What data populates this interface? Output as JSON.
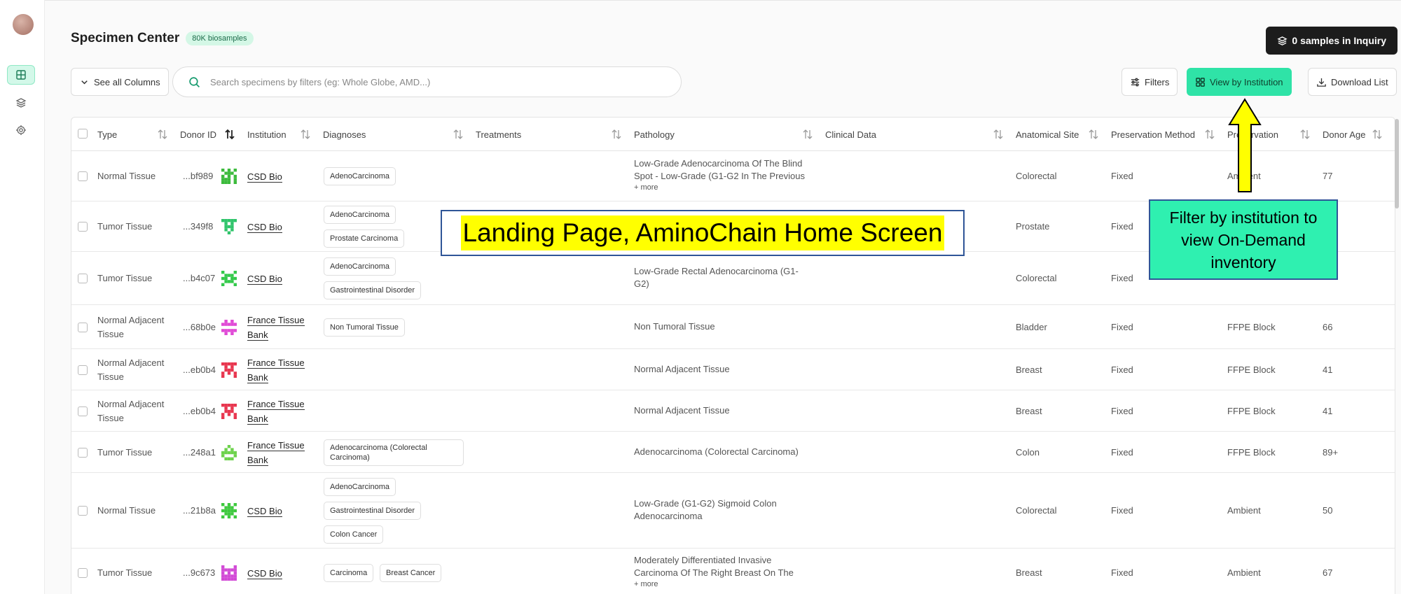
{
  "header": {
    "title": "Specimen Center",
    "badge": "80K biosamples",
    "inquiry_label": "0 samples in Inquiry"
  },
  "toolbar": {
    "see_columns_label": "See all Columns",
    "search_placeholder": "Search specimens by filters (eg: Whole Globe, AMD...)",
    "filters_label": "Filters",
    "view_by_institution_label": "View by Institution",
    "download_label": "Download List"
  },
  "table": {
    "columns": [
      "Type",
      "Donor ID",
      "Institution",
      "Diagnoses",
      "Treatments",
      "Pathology",
      "Clinical Data",
      "Anatomical Site",
      "Preservation Method",
      "Preservation",
      "Donor Age"
    ],
    "rows": [
      {
        "type": [
          "Normal Tissue"
        ],
        "donor_id": "...bf989",
        "identicon_color": "#3cba3c",
        "institution": [
          "CSD Bio"
        ],
        "diagnoses": [
          "AdenoCarcinoma"
        ],
        "pathology": [
          "Low-Grade Adenocarcinoma Of The Blind",
          "Spot - Low-Grade (G1-G2 In The Previous"
        ],
        "more": "+ more",
        "site": "Colorectal",
        "method": "Fixed",
        "preservation": "Ambient",
        "age": "77"
      },
      {
        "type": [
          "Tumor Tissue"
        ],
        "donor_id": "...349f8",
        "identicon_color": "#2fc46a",
        "institution": [
          "CSD Bio"
        ],
        "diagnoses": [
          "AdenoCarcinoma",
          "Prostate Carcinoma"
        ],
        "pathology": [],
        "more": "",
        "site": "Prostate",
        "method": "Fixed",
        "preservation": "",
        "age": ""
      },
      {
        "type": [
          "Tumor Tissue"
        ],
        "donor_id": "...b4c07",
        "identicon_color": "#33c94a",
        "institution": [
          "CSD Bio"
        ],
        "diagnoses": [
          "AdenoCarcinoma",
          "Gastrointestinal Disorder"
        ],
        "pathology": [
          "Low-Grade Rectal Adenocarcinoma (G1-",
          "G2)"
        ],
        "more": "",
        "site": "Colorectal",
        "method": "Fixed",
        "preservation": "",
        "age": ""
      },
      {
        "type": [
          "Normal Adjacent",
          "Tissue"
        ],
        "donor_id": "...68b0e",
        "identicon_color": "#e04ad6",
        "institution": [
          "France Tissue",
          "Bank"
        ],
        "diagnoses": [
          "Non Tumoral Tissue"
        ],
        "pathology": [
          "Non Tumoral Tissue"
        ],
        "more": "",
        "site": "Bladder",
        "method": "Fixed",
        "preservation": "FFPE Block",
        "age": "66"
      },
      {
        "type": [
          "Normal Adjacent",
          "Tissue"
        ],
        "donor_id": "...eb0b4",
        "identicon_color": "#e8364f",
        "institution": [
          "France Tissue",
          "Bank"
        ],
        "diagnoses": [],
        "pathology": [
          "Normal Adjacent Tissue"
        ],
        "more": "",
        "site": "Breast",
        "method": "Fixed",
        "preservation": "FFPE Block",
        "age": "41"
      },
      {
        "type": [
          "Normal Adjacent",
          "Tissue"
        ],
        "donor_id": "...eb0b4",
        "identicon_color": "#e8364f",
        "institution": [
          "France Tissue",
          "Bank"
        ],
        "diagnoses": [],
        "pathology": [
          "Normal Adjacent Tissue"
        ],
        "more": "",
        "site": "Breast",
        "method": "Fixed",
        "preservation": "FFPE Block",
        "age": "41"
      },
      {
        "type": [
          "Tumor Tissue"
        ],
        "donor_id": "...248a1",
        "identicon_color": "#6dd24c",
        "institution": [
          "France Tissue",
          "Bank"
        ],
        "diagnoses": [
          "Adenocarcinoma (Colorectal Carcinoma)"
        ],
        "pathology": [
          "Adenocarcinoma (Colorectal Carcinoma)"
        ],
        "more": "",
        "site": "Colon",
        "method": "Fixed",
        "preservation": "FFPE Block",
        "age": "89+"
      },
      {
        "type": [
          "Normal Tissue"
        ],
        "donor_id": "...21b8a",
        "identicon_color": "#3ec93e",
        "institution": [
          "CSD Bio"
        ],
        "diagnoses": [
          "AdenoCarcinoma",
          "Gastrointestinal Disorder",
          "Colon Cancer"
        ],
        "pathology": [
          "Low-Grade (G1-G2) Sigmoid Colon",
          "Adenocarcinoma"
        ],
        "more": "",
        "site": "Colorectal",
        "method": "Fixed",
        "preservation": "Ambient",
        "age": "50"
      },
      {
        "type": [
          "Tumor Tissue"
        ],
        "donor_id": "...9c673",
        "identicon_color": "#d24bd6",
        "institution": [
          "CSD Bio"
        ],
        "diagnoses": [
          "Carcinoma",
          "Breast Cancer"
        ],
        "pathology": [
          "Moderately Differentiated Invasive",
          "Carcinoma Of The Right Breast On The"
        ],
        "more": "+ more",
        "site": "Breast",
        "method": "Fixed",
        "preservation": "Ambient",
        "age": "67"
      }
    ]
  },
  "annotations": {
    "title": "Landing Page, AminoChain Home Screen",
    "callout": "Filter by institution to view On-Demand inventory"
  },
  "colors": {
    "accent": "#2fe3a7",
    "highlight": "#ffff00",
    "callout": "#2ff0b0",
    "box_border": "#2f5597"
  }
}
